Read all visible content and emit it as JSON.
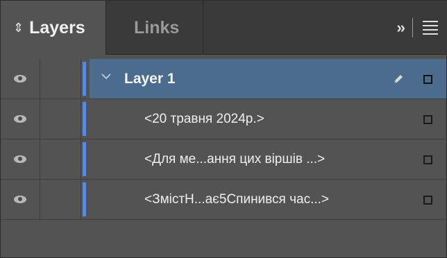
{
  "panel": {
    "tabs": [
      {
        "label": "Layers",
        "active": true
      },
      {
        "label": "Links",
        "active": false
      }
    ],
    "collapse_label": "››",
    "tab_icon": "up-down-arrows-icon",
    "menu_icon": "panel-menu-icon"
  },
  "rows": [
    {
      "name": "Layer 1",
      "type": "layer",
      "selected": true,
      "color": "#4d8cf5"
    },
    {
      "name": "<20 травня 2024р.>",
      "type": "item",
      "selected": false,
      "color": "#4d8cf5"
    },
    {
      "name": "<Для ме...ання цих віршів ...>",
      "type": "item",
      "selected": false,
      "color": "#4d8cf5"
    },
    {
      "name": "<ЗмістН...ає5Спинився час...>",
      "type": "item",
      "selected": false,
      "color": "#4d8cf5"
    }
  ],
  "colors": {
    "panel_bg": "#535353",
    "tabbar_bg": "#3a3a3a",
    "selected_row_bg": "#4b6c8d",
    "layer_color": "#4d8cf5"
  }
}
